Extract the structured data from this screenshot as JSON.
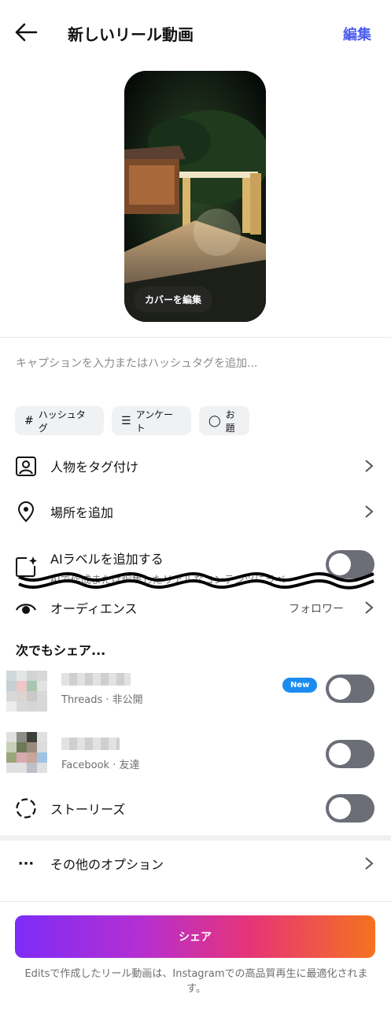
{
  "header": {
    "title": "新しいリール動画",
    "edit": "編集"
  },
  "cover": {
    "button": "カバーを編集"
  },
  "caption": {
    "placeholder": "キャプションを入力またはハッシュタグを追加..."
  },
  "chips": [
    {
      "icon": "hashtag-icon",
      "label": "ハッシュタグ"
    },
    {
      "icon": "poll-icon",
      "label": "アンケート"
    },
    {
      "icon": "prompt-icon",
      "label": "お題"
    }
  ],
  "rows": {
    "tag_people": "人物をタグ付け",
    "add_location": "場所を追加",
    "ai_label": "AIラベルを追加する",
    "ai_label_desc": "AIで作成または編集したリアルなコンテンツにラベ",
    "audience": "オーディエンス",
    "audience_value": "フォロワー"
  },
  "share_section": {
    "heading": "次でもシェア...",
    "threads_sub": "Threads · 非公開",
    "new_badge": "New",
    "facebook_sub": "Facebook · 友達",
    "stories": "ストーリーズ"
  },
  "more_options": "その他のオプション",
  "share_button": "シェア",
  "footer_note": "Editsで作成したリール動画は、Instagramでの高品質再生に最適化されます。",
  "toggles": {
    "ai_label": false,
    "threads": false,
    "facebook": false,
    "stories": false
  },
  "colors": {
    "accent": "#4a5cf0",
    "toggle_off": "#6b6e76",
    "badge": "#1a8cf0"
  }
}
